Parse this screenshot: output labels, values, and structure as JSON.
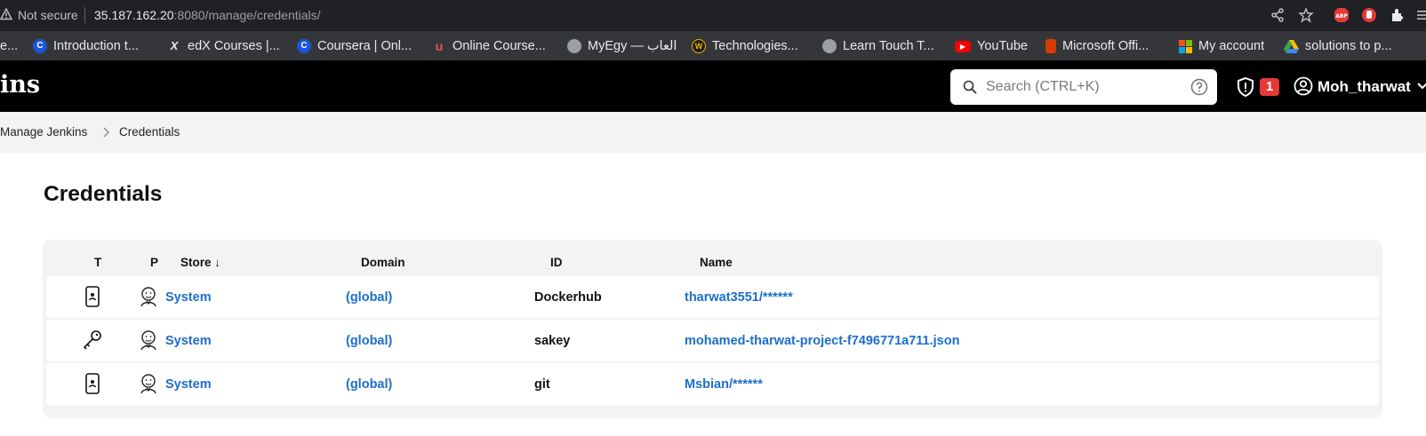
{
  "browser": {
    "security_label": "Not secure",
    "url_host": "35.187.162.20",
    "url_rest": ":8080/manage/credentials/",
    "bookmarks": [
      {
        "label": "e...",
        "icon": "partial-bookmark"
      },
      {
        "label": "Introduction t...",
        "icon": "coursera-icon"
      },
      {
        "label": "edX Courses |...",
        "icon": "edx-icon"
      },
      {
        "label": "Coursera | Onl...",
        "icon": "coursera-icon"
      },
      {
        "label": "Online Course...",
        "icon": "udemy-icon"
      },
      {
        "label": "MyEgy — العاب",
        "icon": "globe-icon"
      },
      {
        "label": "Technologies...",
        "icon": "w-icon"
      },
      {
        "label": "Learn Touch T...",
        "icon": "globe-icon"
      },
      {
        "label": "YouTube",
        "icon": "youtube-icon"
      },
      {
        "label": "Microsoft Offi...",
        "icon": "office-icon"
      },
      {
        "label": "My account",
        "icon": "microsoft-icon"
      },
      {
        "label": "solutions to p...",
        "icon": "drive-icon"
      }
    ]
  },
  "header": {
    "logo_text": "ins",
    "search_placeholder": "Search (CTRL+K)",
    "security_badge_count": "1",
    "user_name": "Moh_tharwat"
  },
  "breadcrumb": {
    "items": [
      "Manage Jenkins",
      "Credentials"
    ]
  },
  "page": {
    "title": "Credentials"
  },
  "table": {
    "headers": {
      "t": "T",
      "p": "P",
      "store": "Store ↓",
      "domain": "Domain",
      "id": "ID",
      "name": "Name"
    },
    "rows": [
      {
        "type_icon": "phone-icon",
        "store": "System",
        "domain": "(global)",
        "id": "Dockerhub",
        "name": "tharwat3551/******"
      },
      {
        "type_icon": "key-icon",
        "store": "System",
        "domain": "(global)",
        "id": "sakey",
        "name": "mohamed-tharwat-project-f7496771a711.json"
      },
      {
        "type_icon": "phone-icon",
        "store": "System",
        "domain": "(global)",
        "id": "git",
        "name": "Msbian/******"
      }
    ]
  },
  "colors": {
    "header_bg": "#000000",
    "link": "#1d6fc8",
    "badge": "#e53935"
  }
}
